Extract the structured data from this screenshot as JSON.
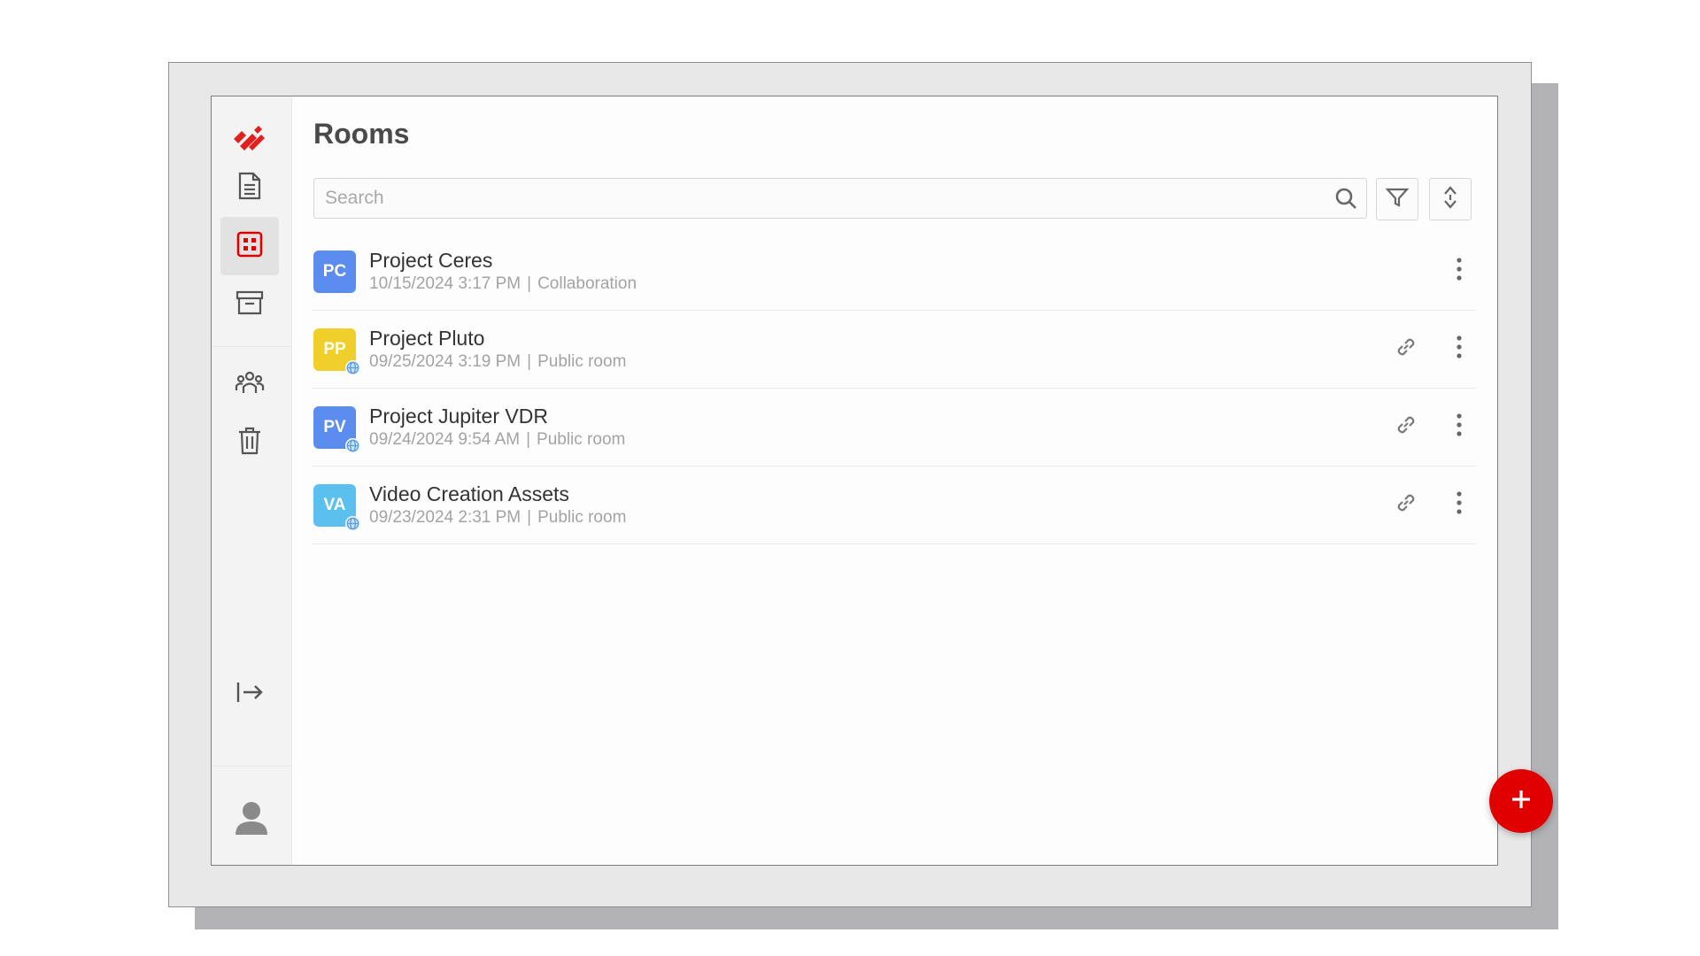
{
  "app": {
    "logo_icon": "brand-logo-icon",
    "accent_color": "#e00000"
  },
  "sidebar": {
    "items": [
      {
        "name": "files",
        "icon": "document-icon",
        "active": false
      },
      {
        "name": "rooms",
        "icon": "rooms-grid-icon",
        "active": true
      },
      {
        "name": "archive",
        "icon": "archive-icon",
        "active": false
      },
      {
        "name": "contacts",
        "icon": "people-icon",
        "active": false
      },
      {
        "name": "trash",
        "icon": "trash-icon",
        "active": false
      },
      {
        "name": "logout",
        "icon": "logout-arrow-icon",
        "active": false
      }
    ],
    "user_icon": "user-avatar-icon"
  },
  "header": {
    "title": "Rooms"
  },
  "search": {
    "placeholder": "Search",
    "value": ""
  },
  "toolbar": {
    "filter_icon": "filter-icon",
    "sort_icon": "sort-icon"
  },
  "rooms": [
    {
      "initials": "PC",
      "title": "Project Ceres",
      "date": "10/15/2024 3:17 PM",
      "separator": "|",
      "type": "Collaboration",
      "color": "#5b8def",
      "public": false
    },
    {
      "initials": "PP",
      "title": "Project Pluto",
      "date": "09/25/2024 3:19 PM",
      "separator": "|",
      "type": "Public room",
      "color": "#f0cf2a",
      "public": true
    },
    {
      "initials": "PV",
      "title": "Project Jupiter VDR",
      "date": "09/24/2024 9:54 AM",
      "separator": "|",
      "type": "Public room",
      "color": "#5b8def",
      "public": true
    },
    {
      "initials": "VA",
      "title": "Video Creation Assets",
      "date": "09/23/2024 2:31 PM",
      "separator": "|",
      "type": "Public room",
      "color": "#5cc0ee",
      "public": true
    }
  ],
  "fab": {
    "label": "+",
    "color": "#e00000"
  }
}
